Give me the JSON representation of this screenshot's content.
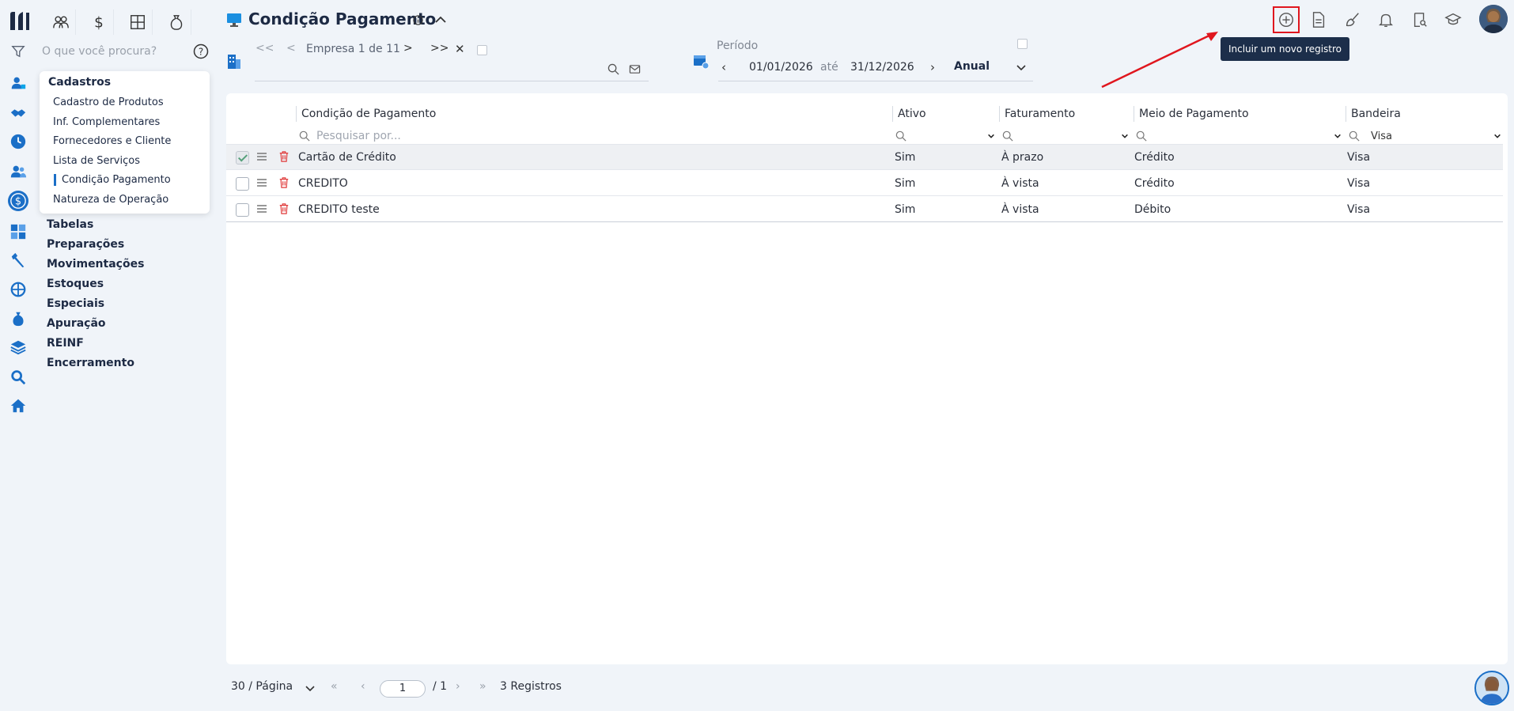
{
  "header": {
    "title": "Condição Pagamento",
    "tooltip": "Incluir um novo registro"
  },
  "search": {
    "placeholder": "O que você procura?"
  },
  "menu": {
    "title": "Cadastros",
    "items": [
      {
        "label": "Cadastro de Produtos"
      },
      {
        "label": "Inf. Complementares"
      },
      {
        "label": "Fornecedores e Cliente"
      },
      {
        "label": "Lista de Serviços"
      },
      {
        "label": "Condição Pagamento"
      },
      {
        "label": "Natureza de Operação"
      }
    ]
  },
  "nav_groups": [
    "Tabelas",
    "Preparações",
    "Movimentações",
    "Estoques",
    "Especiais",
    "Apuração",
    "REINF",
    "Encerramento"
  ],
  "company": {
    "label": "Empresa 1 de 11"
  },
  "period": {
    "label": "Período",
    "start": "01/01/2026",
    "sep": "até",
    "end": "31/12/2026",
    "mode": "Anual"
  },
  "grid": {
    "columns": [
      "Condição de Pagamento",
      "Ativo",
      "Faturamento",
      "Meio de Pagamento",
      "Bandeira"
    ],
    "search_placeholder": "Pesquisar por...",
    "bandeira_filter": "Visa",
    "rows": [
      {
        "name": "Cartão de Crédito",
        "ativo": "Sim",
        "faturamento": "À prazo",
        "meio": "Crédito",
        "bandeira": "Visa",
        "selected": true
      },
      {
        "name": "CREDITO",
        "ativo": "Sim",
        "faturamento": "À vista",
        "meio": "Crédito",
        "bandeira": "Visa",
        "selected": false
      },
      {
        "name": "CREDITO teste",
        "ativo": "Sim",
        "faturamento": "À vista",
        "meio": "Débito",
        "bandeira": "Visa",
        "selected": false
      }
    ]
  },
  "footer": {
    "per_page": "30 / Página",
    "page": "1",
    "total_pages": "/ 1",
    "records": "3 Registros"
  },
  "colors": {
    "accent": "#1b6fc7",
    "danger": "#e03a3a",
    "tooltip_bg": "#1c2e4a",
    "highlight": "#e0161e"
  }
}
